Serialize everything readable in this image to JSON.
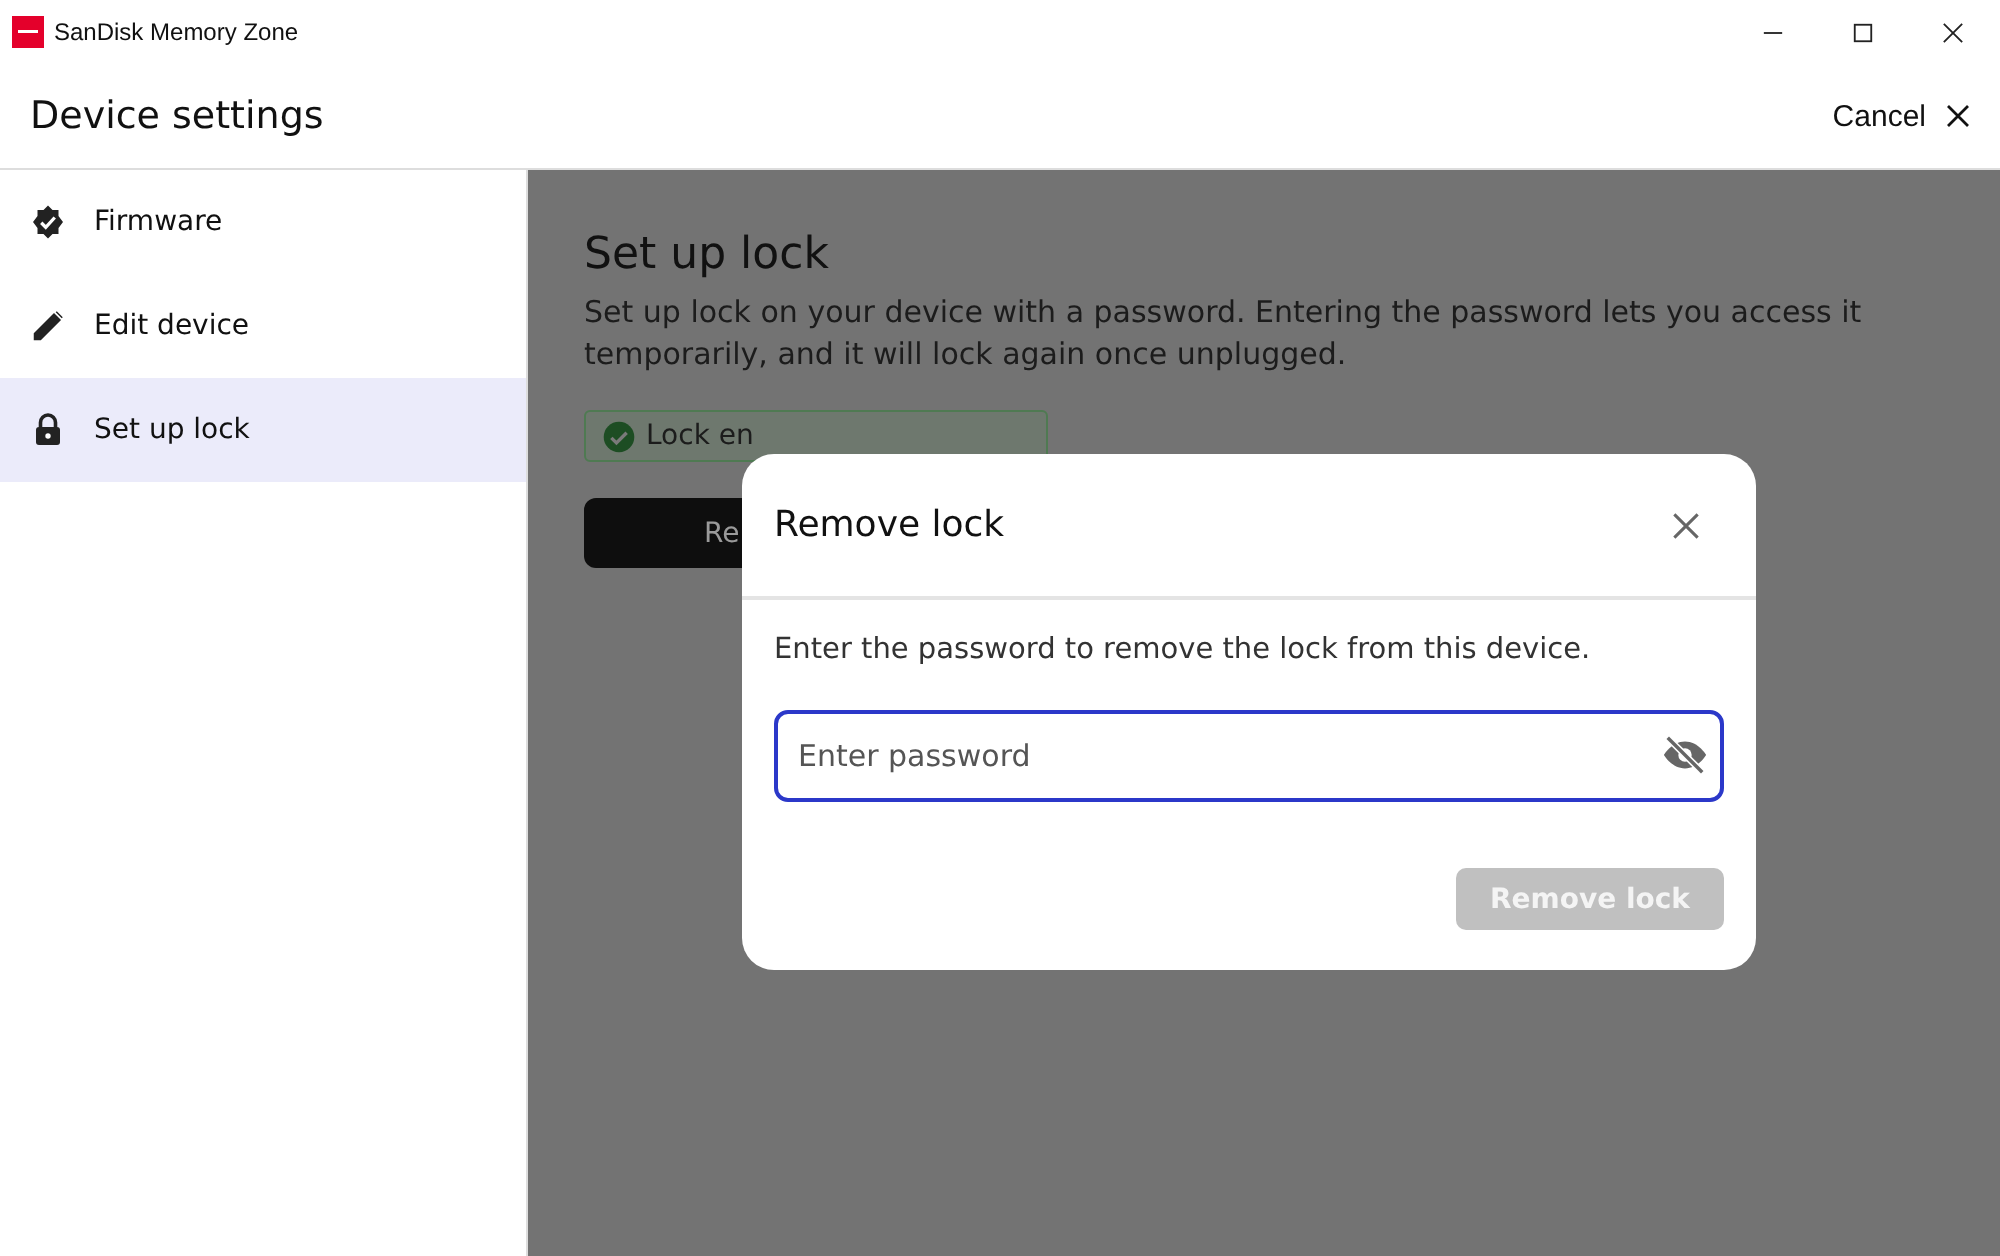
{
  "window": {
    "title": "SanDisk Memory Zone"
  },
  "header": {
    "title": "Device settings",
    "cancel": "Cancel"
  },
  "sidebar": {
    "items": [
      {
        "label": "Firmware",
        "kind": "badge",
        "selected": false
      },
      {
        "label": "Edit device",
        "kind": "pencil",
        "selected": false
      },
      {
        "label": "Set up lock",
        "kind": "lock",
        "selected": true
      }
    ]
  },
  "main": {
    "title": "Set up lock",
    "description": "Set up lock on your device with a password. Entering the password lets you access it temporarily, and it will lock again once unplugged.",
    "status": "Lock en",
    "button": "Re"
  },
  "dialog": {
    "title": "Remove lock",
    "message": "Enter the password to remove the lock from this device.",
    "field": {
      "placeholder": "Enter password"
    },
    "button": {
      "label": "Remove lock",
      "disabled": true
    }
  }
}
